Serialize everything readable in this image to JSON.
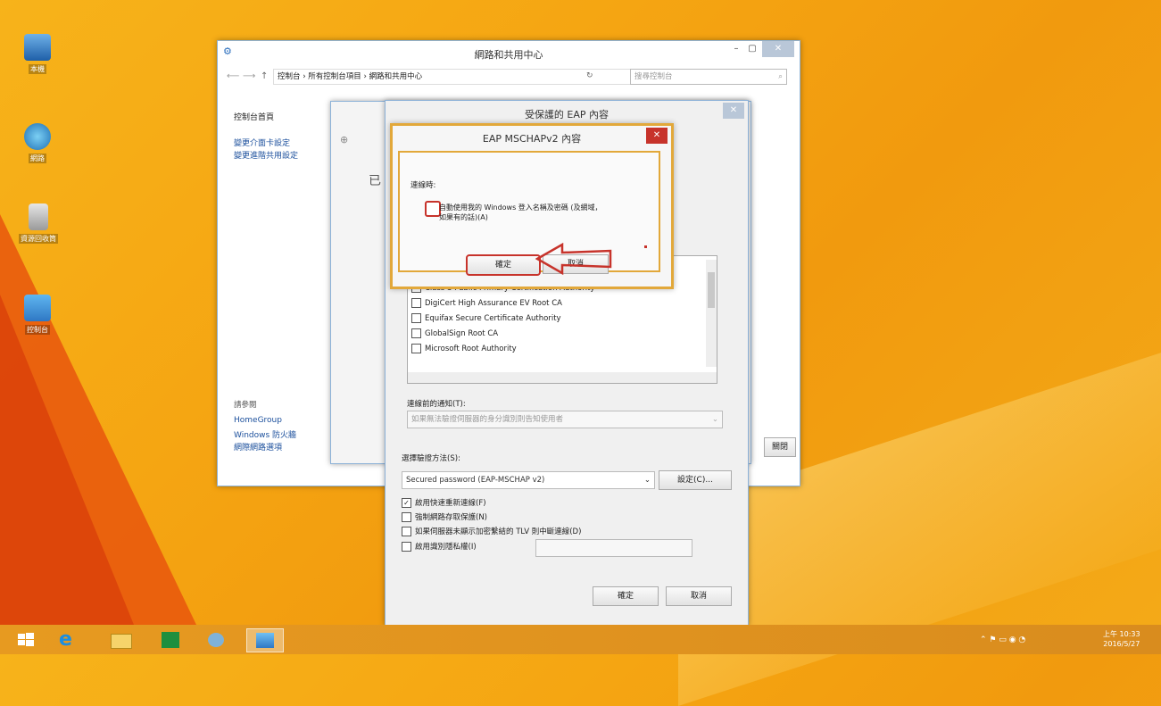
{
  "desktop": {
    "icons": [
      {
        "label": "本機",
        "icon": "computer-icon"
      },
      {
        "label": "網路",
        "icon": "network-icon"
      },
      {
        "label": "資源回收筒",
        "icon": "recycle-bin-icon"
      },
      {
        "label": "控制台",
        "icon": "control-panel-icon"
      }
    ]
  },
  "network_center": {
    "title": "網路和共用中心",
    "breadcrumb": "控制台 › 所有控制台項目 › 網路和共用中心",
    "search_placeholder": "搜尋控制台",
    "sidebar_home": "控制台首頁",
    "sidebar_links": [
      "變更介面卡設定",
      "變更進階共用設定"
    ],
    "see_also": "請參閱",
    "see_also_links": [
      "HomeGroup",
      "Windows 防火牆",
      "網際網路選項"
    ],
    "right_button": "關閉",
    "content_char": "已"
  },
  "peap": {
    "title": "受保護的 EAP 內容",
    "cert_list": [
      "Class 3 Public Primary Certification Authority",
      "DigiCert High Assurance EV Root CA",
      "Equifax Secure Certificate Authority",
      "GlobalSign Root CA",
      "Microsoft Root Authority"
    ],
    "notify_label": "連線前的通知(T):",
    "notify_value": "如果無法驗證伺服器的身分識別則告知使用者",
    "auth_method_label": "選擇驗證方法(S):",
    "auth_method_value": "Secured password (EAP-MSCHAP v2)",
    "configure_button": "設定(C)...",
    "options": [
      {
        "label": "啟用快速重新連線(F)",
        "checked": true
      },
      {
        "label": "強制網路存取保護(N)",
        "checked": false
      },
      {
        "label": "如果伺服器未顯示加密繫結的 TLV 則中斷連線(D)",
        "checked": false
      },
      {
        "label": "啟用識別隱私權(I)",
        "checked": false
      }
    ],
    "ok_button": "確定",
    "cancel_button": "取消"
  },
  "mschap": {
    "title": "EAP MSCHAPv2 內容",
    "when_connecting": "連線時:",
    "checkbox_label_line1": "自動使用我的 Windows 登入名稱及密碼 (及網域，",
    "checkbox_label_line2": "如果有的話)(A)",
    "ok_button": "確定",
    "cancel_button": "取消"
  },
  "taskbar": {
    "clock_time": "上午 10:33",
    "clock_date": "2016/5/27",
    "apps": [
      "start-icon",
      "ie-icon",
      "explorer-icon",
      "store-icon",
      "network-settings-icon",
      "control-panel-icon"
    ]
  },
  "colors": {
    "highlight_red": "#c7332b",
    "dialog_border": "#e2a83a"
  }
}
